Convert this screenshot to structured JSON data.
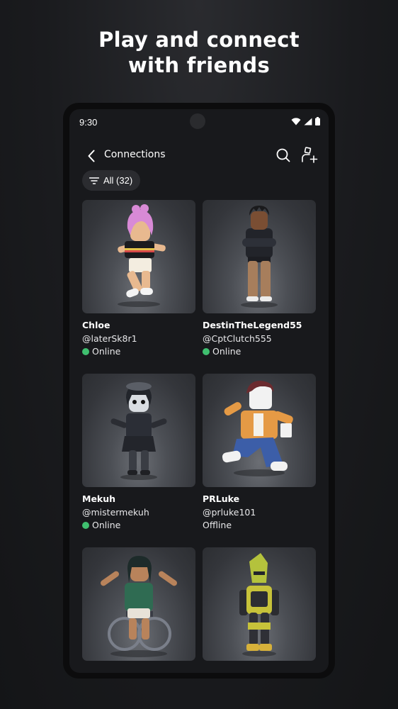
{
  "promo": {
    "title_line1": "Play and connect",
    "title_line2": "with friends"
  },
  "status_bar": {
    "time": "9:30",
    "icons": [
      "wifi-icon",
      "cellular-signal-icon",
      "battery-icon"
    ]
  },
  "header": {
    "title": "Connections",
    "back_icon": "chevron-left-icon",
    "actions": [
      "search-icon",
      "add-friend-icon"
    ]
  },
  "filter": {
    "label": "All (32)",
    "icon": "filter-icon"
  },
  "colors": {
    "background": "#18191c",
    "online": "#3fbf6f",
    "chip": "#2b2c30"
  },
  "connections": [
    {
      "name": "Chloe",
      "handle": "@laterSk8r1",
      "status": "Online",
      "online": true,
      "avatar": "avatar-chloe"
    },
    {
      "name": "DestinTheLegend55",
      "handle": "@CptClutch555",
      "status": "Online",
      "online": true,
      "avatar": "avatar-destin"
    },
    {
      "name": "Mekuh",
      "handle": "@mistermekuh",
      "status": "Online",
      "online": true,
      "avatar": "avatar-mekuh"
    },
    {
      "name": "PRLuke",
      "handle": "@prluke101",
      "status": "Offline",
      "online": false,
      "avatar": "avatar-prluke"
    },
    {
      "name": "",
      "handle": "",
      "status": "",
      "online": false,
      "avatar": "avatar-wheelchair"
    },
    {
      "name": "",
      "handle": "",
      "status": "",
      "online": false,
      "avatar": "avatar-robot"
    }
  ]
}
